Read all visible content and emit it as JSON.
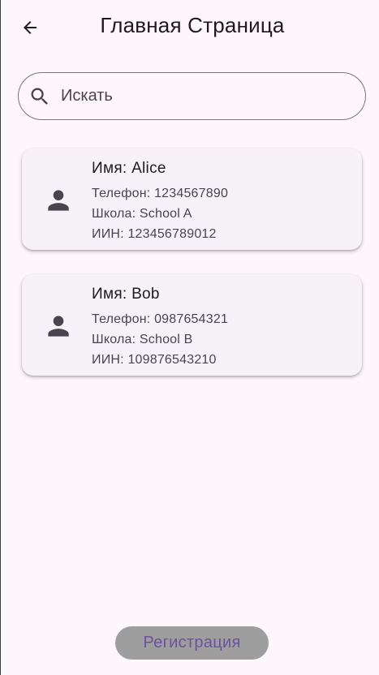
{
  "app_bar": {
    "back_icon": "arrow-left-icon",
    "title": "Главная Страница"
  },
  "search": {
    "icon": "search-icon",
    "placeholder": "Искать",
    "value": ""
  },
  "students": [
    {
      "icon": "person-icon",
      "name": "Имя: Alice",
      "phone": "Телефон: 1234567890",
      "school": "Школа: School A",
      "iin": "ИИН: 123456789012"
    },
    {
      "icon": "person-icon",
      "name": "Имя: Bob",
      "phone": "Телефон: 0987654321",
      "school": "Школа: School B",
      "iin": "ИИН: 109876543210"
    }
  ],
  "footer": {
    "register_label": "Регистрация"
  },
  "colors": {
    "background": "#fdf7fc",
    "card": "#f7f2f7",
    "icon": "#49454f",
    "button_bg": "#9e9e9f",
    "button_text": "#6a52a2"
  }
}
